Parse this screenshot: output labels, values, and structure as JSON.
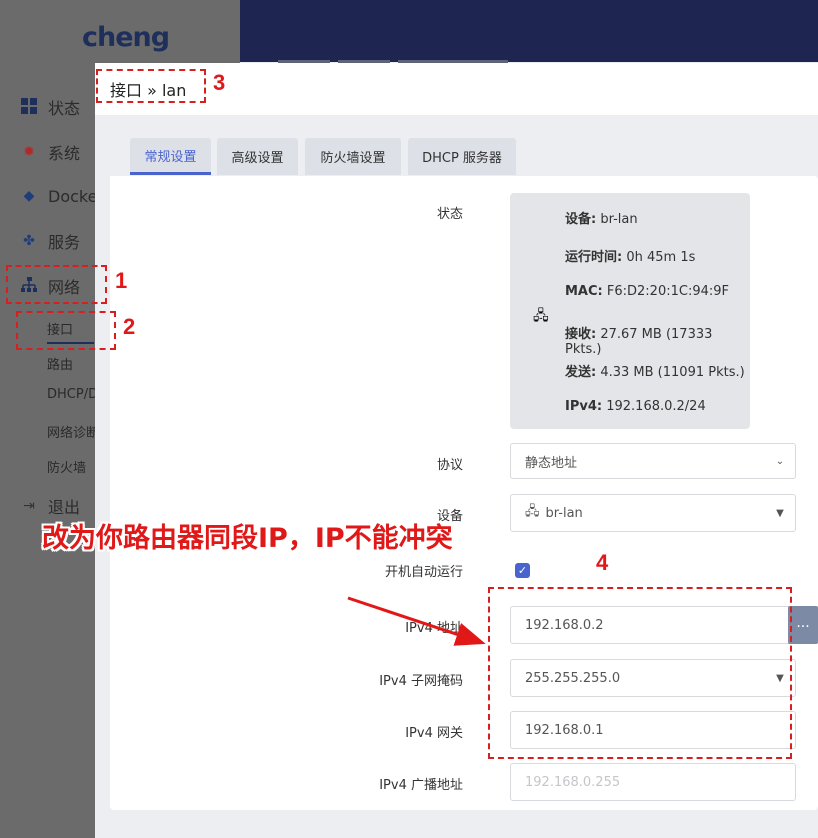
{
  "app": {
    "logo": "cheng"
  },
  "sidebar": {
    "items": [
      {
        "label": "状态",
        "icon": "grid-icon"
      },
      {
        "label": "系统",
        "icon": "gear-icon"
      },
      {
        "label": "Docker",
        "icon": "docker-icon"
      },
      {
        "label": "服务",
        "icon": "puzzle-icon"
      },
      {
        "label": "网络",
        "icon": "network-icon"
      },
      {
        "label": "退出",
        "icon": "logout-icon"
      }
    ],
    "network_sub": [
      "接口",
      "路由",
      "DHCP/D",
      "网络诊断",
      "防火墙"
    ]
  },
  "modal": {
    "breadcrumb": "接口 » lan",
    "tabs": [
      "常规设置",
      "高级设置",
      "防火墙设置",
      "DHCP 服务器"
    ],
    "active_tab": "常规设置",
    "status_label": "状态",
    "status": {
      "device_key": "设备:",
      "device_val": " br-lan",
      "uptime_key": "运行时间:",
      "uptime_val": " 0h 45m 1s",
      "mac_key": "MAC:",
      "mac_val": " F6:D2:20:1C:94:9F",
      "rx_key": "接收:",
      "rx_val": " 27.67 MB (17333 Pkts.)",
      "tx_key": "发送:",
      "tx_val": " 4.33 MB (11091 Pkts.)",
      "ipv4_key": "IPv4:",
      "ipv4_val": " 192.168.0.2/24"
    },
    "protocol_label": "协议",
    "protocol_value": "静态地址",
    "device_label": "设备",
    "device_value": "br-lan",
    "autostart_label": "开机自动运行",
    "autostart_checked": true,
    "ipv4_addr_label": "IPv4 地址",
    "ipv4_addr_value": "192.168.0.2",
    "ipv4_mask_label": "IPv4 子网掩码",
    "ipv4_mask_value": "255.255.255.0",
    "ipv4_gw_label": "IPv4 网关",
    "ipv4_gw_value": "192.168.0.1",
    "ipv4_bcast_label": "IPv4 广播地址",
    "ipv4_bcast_placeholder": "192.168.0.255",
    "more_button": "..."
  },
  "annotations": {
    "n1": "1",
    "n2": "2",
    "n3": "3",
    "n4": "4",
    "instruction": "改为你路由器同段IP，IP不能冲突",
    "color": "#e01818"
  }
}
